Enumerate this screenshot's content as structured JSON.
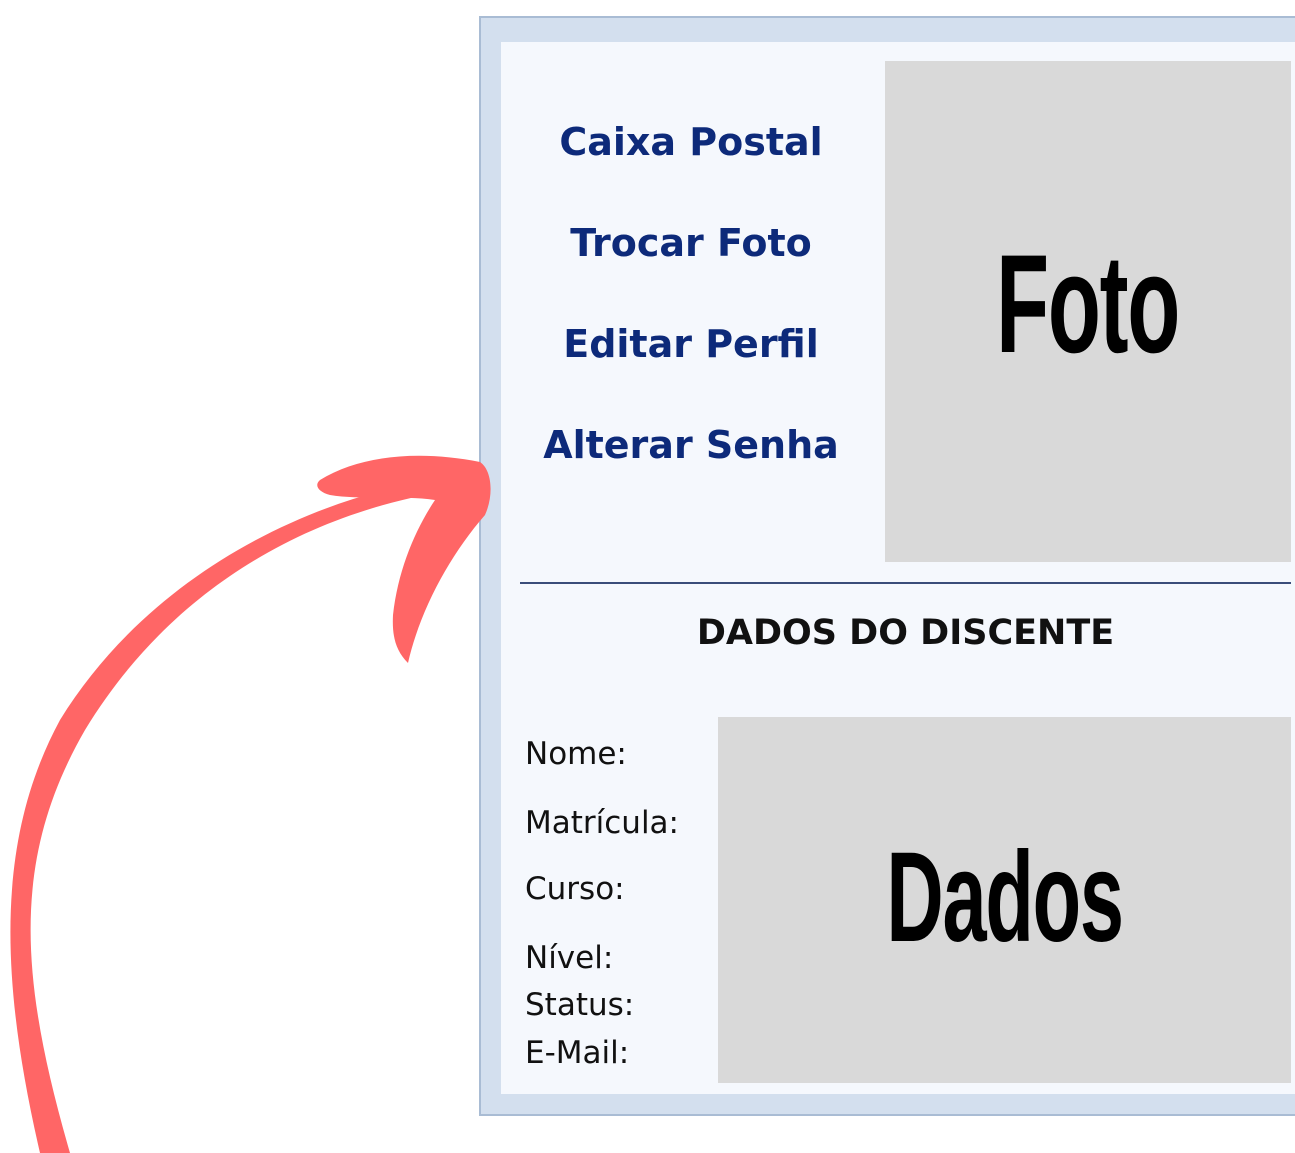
{
  "menu": {
    "items": [
      {
        "label": "Caixa Postal"
      },
      {
        "label": "Trocar Foto"
      },
      {
        "label": "Editar Perfil"
      },
      {
        "label": "Alterar Senha"
      }
    ]
  },
  "photo": {
    "label": "Foto"
  },
  "student": {
    "section_title": "DADOS DO DISCENTE",
    "fields": [
      {
        "label": "Nome:"
      },
      {
        "label": "Matrícula:"
      },
      {
        "label": "Curso:"
      },
      {
        "label": "Nível:"
      },
      {
        "label": "Status:"
      },
      {
        "label": "E-Mail:"
      }
    ],
    "data_placeholder": "Dados"
  },
  "colors": {
    "link": "#0d2a7a",
    "panel_border": "#a9bcd4",
    "panel_bg": "#d3dfee",
    "inner_bg": "#f5f8fd",
    "placeholder_bg": "#d9d9d9",
    "arrow": "#ff6666"
  }
}
